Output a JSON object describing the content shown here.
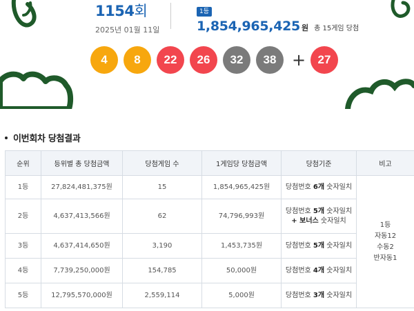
{
  "draw": {
    "round_number": "1154",
    "round_suffix": "회",
    "date": "2025년 01월 11일",
    "rank_badge": "1등",
    "first_prize_amount": "1,854,965,425",
    "first_prize_unit": "원",
    "first_prize_games": "총 15게임 당첨",
    "numbers": [
      {
        "value": "4",
        "color": "#f7a70e"
      },
      {
        "value": "8",
        "color": "#f7a70e"
      },
      {
        "value": "22",
        "color": "#f2464e"
      },
      {
        "value": "26",
        "color": "#f2464e"
      },
      {
        "value": "32",
        "color": "#7b7b7b"
      },
      {
        "value": "38",
        "color": "#7b7b7b"
      }
    ],
    "plus": "+",
    "bonus": {
      "value": "27",
      "color": "#f2464e"
    }
  },
  "section": {
    "title": "이번회차 당첨결과"
  },
  "table": {
    "headers": [
      "순위",
      "등위별 총 당첨금액",
      "당첨게임 수",
      "1게임당 당첨금액",
      "당첨기준",
      "비고"
    ],
    "rows": [
      {
        "rank": "1등",
        "total": "27,824,481,375원",
        "games": "15",
        "per_game": "1,854,965,425원",
        "criteria_pre": "당첨번호 ",
        "criteria_bold": "6개",
        "criteria_post": " 숫자일치",
        "criteria_line2_bold": "",
        "criteria_line2": ""
      },
      {
        "rank": "2등",
        "total": "4,637,413,566원",
        "games": "62",
        "per_game": "74,796,993원",
        "criteria_pre": "당첨번호 ",
        "criteria_bold": "5개",
        "criteria_post": " 숫자일치",
        "criteria_line2_bold": "+ 보너스",
        "criteria_line2": " 숫자일치"
      },
      {
        "rank": "3등",
        "total": "4,637,414,650원",
        "games": "3,190",
        "per_game": "1,453,735원",
        "criteria_pre": "당첨번호 ",
        "criteria_bold": "5개",
        "criteria_post": " 숫자일치",
        "criteria_line2_bold": "",
        "criteria_line2": ""
      },
      {
        "rank": "4등",
        "total": "7,739,250,000원",
        "games": "154,785",
        "per_game": "50,000원",
        "criteria_pre": "당첨번호 ",
        "criteria_bold": "4개",
        "criteria_post": " 숫자일치",
        "criteria_line2_bold": "",
        "criteria_line2": ""
      },
      {
        "rank": "5등",
        "total": "12,795,570,000원",
        "games": "2,559,114",
        "per_game": "5,000원",
        "criteria_pre": "당첨번호 ",
        "criteria_bold": "3개",
        "criteria_post": " 숫자일치",
        "criteria_line2_bold": "",
        "criteria_line2": ""
      }
    ],
    "remarks": [
      "1등",
      "자동12",
      "수동2",
      "반자동1"
    ]
  },
  "colors": {
    "accent_blue": "#1b64b3",
    "deco_green": "#1f5a2a",
    "ball_yellow": "#f7a70e",
    "ball_red": "#f2464e",
    "ball_gray": "#7b7b7b"
  }
}
